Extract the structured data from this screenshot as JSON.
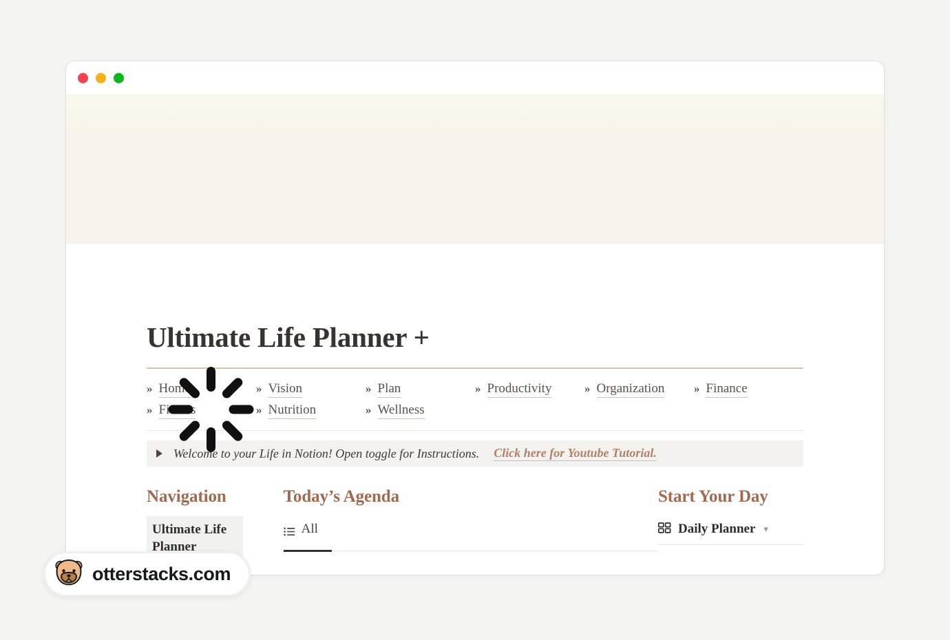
{
  "window": {
    "traffic_lights": [
      {
        "name": "close",
        "color": "#f5424f"
      },
      {
        "name": "minimize",
        "color": "#f5b115"
      },
      {
        "name": "maximize",
        "color": "#09b815"
      }
    ]
  },
  "cover": {
    "icon": "loading-spinner-icon",
    "background_color": "#f7f3ea"
  },
  "page": {
    "title": "Ultimate Life Planner +",
    "divider_color": "#d9c3a3"
  },
  "nav_links": [
    {
      "marker": "»",
      "label": "Home"
    },
    {
      "marker": "»",
      "label": "Vision"
    },
    {
      "marker": "»",
      "label": "Plan"
    },
    {
      "marker": "»",
      "label": "Productivity"
    },
    {
      "marker": "»",
      "label": "Organization"
    },
    {
      "marker": "»",
      "label": "Finance"
    },
    {
      "marker": "»",
      "label": "Fitness"
    },
    {
      "marker": "»",
      "label": "Nutrition"
    },
    {
      "marker": "»",
      "label": "Wellness"
    }
  ],
  "callout": {
    "toggle_icon": "triangle-right-icon",
    "text": "Welcome to your Life in Notion! Open toggle for Instructions.",
    "link_text": "Click here for Youtube Tutorial.",
    "link_color": "#b08167",
    "background_color": "#f3f2ef"
  },
  "columns": {
    "navigation": {
      "heading": "Navigation",
      "heading_color": "#a06a51",
      "item": "Ultimate Life Planner"
    },
    "agenda": {
      "heading": "Today’s Agenda",
      "heading_color": "#a06a51",
      "tab": {
        "icon": "list-view-icon",
        "label": "All",
        "active": "true"
      }
    },
    "start_your_day": {
      "heading": "Start Your Day",
      "heading_color": "#a06a51",
      "item": {
        "icon": "gallery-grid-icon",
        "label": "Daily Planner",
        "chevron": "chevron-down-icon"
      }
    }
  },
  "watermark": {
    "logo": "otter-face-icon",
    "text": "otterstacks.com"
  }
}
